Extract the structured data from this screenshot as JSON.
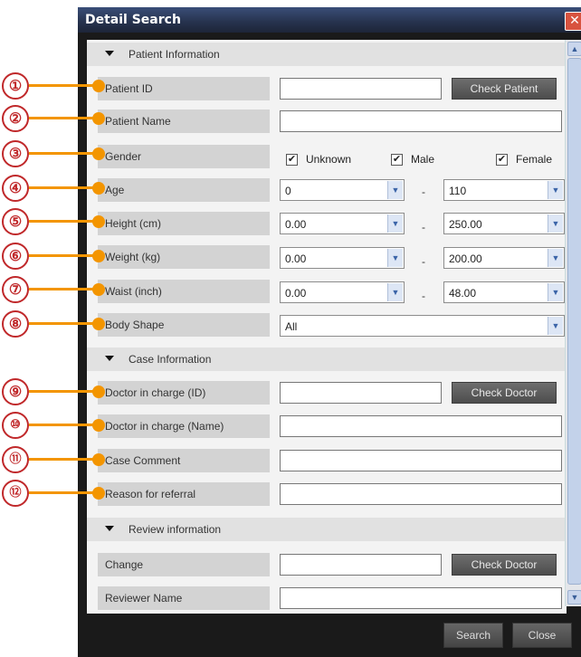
{
  "window": {
    "title": "Detail Search",
    "close_glyph": "✕"
  },
  "sections": {
    "patient": "Patient Information",
    "case": "Case Information",
    "review": "Review information"
  },
  "labels": {
    "patient_id": "Patient ID",
    "patient_name": "Patient Name",
    "gender": "Gender",
    "age": "Age",
    "height": "Height (cm)",
    "weight": "Weight (kg)",
    "waist": "Waist (inch)",
    "body_shape": "Body Shape",
    "doctor_id": "Doctor in charge (ID)",
    "doctor_name": "Doctor in charge (Name)",
    "case_comment": "Case Comment",
    "reason": "Reason for referral",
    "change": "Change",
    "reviewer_name": "Reviewer Name"
  },
  "buttons": {
    "check_patient": "Check Patient",
    "check_doctor": "Check Doctor",
    "check_doctor_review": "Check Doctor",
    "search": "Search",
    "close": "Close"
  },
  "gender": {
    "unknown": "Unknown",
    "male": "Male",
    "female": "Female"
  },
  "ranges": {
    "age_from": "0",
    "age_to": "110",
    "height_from": "0.00",
    "height_to": "250.00",
    "weight_from": "0.00",
    "weight_to": "200.00",
    "waist_from": "0.00",
    "waist_to": "48.00",
    "dash": "-"
  },
  "body_shape_value": "All",
  "callouts": [
    "①",
    "②",
    "③",
    "④",
    "⑤",
    "⑥",
    "⑦",
    "⑧",
    "⑨",
    "⑩",
    "⑪",
    "⑫"
  ],
  "colors": {
    "callout_line": "#f39500",
    "callout_circle": "#c0282a"
  }
}
